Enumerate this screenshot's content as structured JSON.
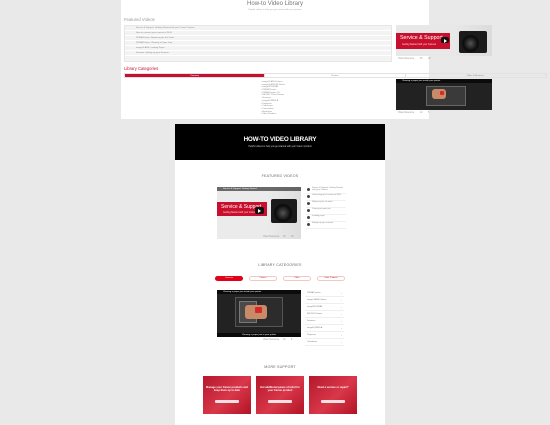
{
  "top": {
    "title": "How-to Video Library",
    "subtitle": "Helpful videos to help you get started with your product",
    "featured_heading": "Featured Videos",
    "featured_list": [
      "Service & Support: Getting Started with your Canon Camera",
      "How to connect your camera to Wi-Fi",
      "PIXMA Printer: Replacing the Ink Tanks",
      "PIXMA Printer: Clearing a Paper Jam",
      "imageCLASS: Loading Paper",
      "Scanner: Setting up your Scanner"
    ],
    "video1": {
      "brand_line": "Service & Support",
      "brand_sub": "Getting Started with your Camera",
      "meta_views": "Video Resource",
      "meta_likes": "45",
      "meta_comments": "18"
    },
    "categories_heading": "Library Categories",
    "tabs": [
      "Cameras",
      "Printers",
      "Office & Business"
    ],
    "category_items": [
      "imageCLASS Printers",
      "imageCLASS MF Series",
      "imagePROGRAF",
      "PIXMA Printers",
      "PIXMA Printers TS",
      "SELPHY Photo Printers",
      "Scanners",
      "imageFORMULA",
      "Projectors",
      "Calculators",
      "Camcorders",
      "Binoculars",
      "Other Products"
    ],
    "video2": {
      "bar_title": "Clearing a paper jam inside your printer",
      "meta_views": "Video Resource",
      "meta_likes": "12",
      "meta_comments": "5"
    }
  },
  "bottom": {
    "hero_title": "HOW-TO VIDEO LIBRARY",
    "hero_subtitle": "Helpful videos to help you get started with your Canon product",
    "featured_heading": "FEATURED VIDEOS",
    "feat_video": {
      "brand_line": "Service & Support",
      "brand_sub": "Getting Started with your Camera",
      "bar_title": "Service & Support: Getting Started",
      "meta_views": "Video Resource",
      "meta_likes": "45",
      "meta_comments": "18"
    },
    "featured_list": [
      "Service & Support: Getting Started with your Camera",
      "Connecting your camera to Wi-Fi",
      "Replacing the ink tanks",
      "Clearing a paper jam",
      "Loading paper",
      "Setting up your scanner"
    ],
    "categories_heading": "LIBRARY CATEGORIES",
    "tabs": [
      "Cameras",
      "Printers",
      "Office",
      "Other Products"
    ],
    "cat_video": {
      "bar_title": "Clearing a paper jam inside your printer",
      "caption": "Clearing a paper jam in your printer",
      "meta_views": "Video Resource",
      "meta_likes": "12",
      "meta_comments": "5"
    },
    "category_list": [
      "PIXMA Printers",
      "imageCLASS Printers",
      "imagePROGRAF",
      "SELPHY Printers",
      "Scanners",
      "imageFORMULA",
      "Projectors",
      "Calculators"
    ],
    "more_support_heading": "MORE SUPPORT",
    "promos": [
      "Manage your Canon products and keep them up to date",
      "Get additional peace of mind for your Canon product",
      "Need a service or repair?"
    ]
  },
  "colors": {
    "brand_red": "#c8102e",
    "hero_black": "#000000"
  }
}
